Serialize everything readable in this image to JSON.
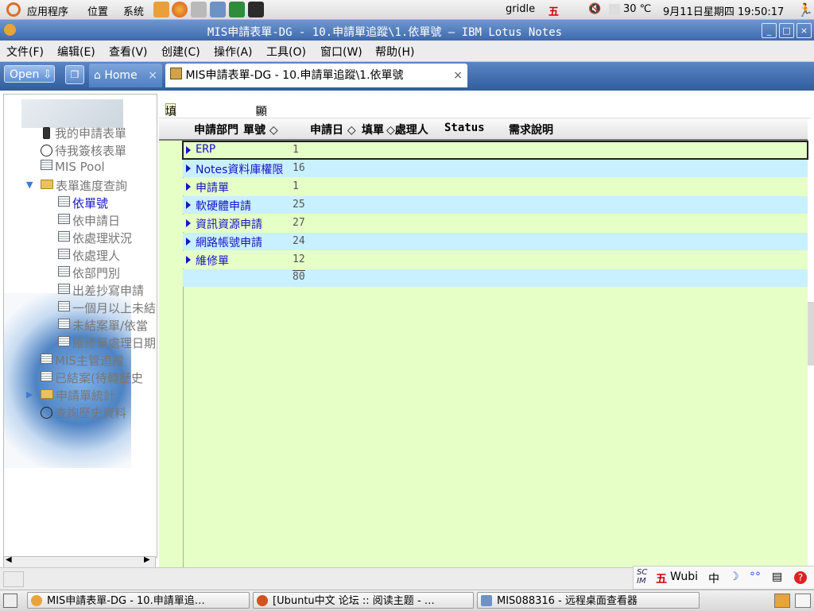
{
  "top_panel": {
    "menus": [
      "应用程序",
      "位置",
      "系统"
    ],
    "user": "gridle",
    "ime_indicator": "五",
    "temperature": "30 ℃",
    "datetime": "9月11日星期四 19:50:17"
  },
  "window": {
    "title": "MIS申請表單-DG - 10.申請單追蹤\\1.依單號 — IBM Lotus Notes"
  },
  "menubar": [
    "文件(F)",
    "编辑(E)",
    "查看(V)",
    "创建(C)",
    "操作(A)",
    "工具(O)",
    "窗口(W)",
    "帮助(H)"
  ],
  "tabs": {
    "open_label": "Open",
    "home_label": "Home",
    "active_label": "MIS申請表單-DG - 10.申請單追蹤\\1.依單號",
    "close_glyph": "×"
  },
  "navigator": {
    "items": [
      {
        "label": "我的申請表單",
        "icon": "person-icon",
        "level": 0
      },
      {
        "label": "待我簽核表單",
        "icon": "pen-icon",
        "level": 0
      },
      {
        "label": "MIS Pool",
        "icon": "view-icon",
        "level": 0
      },
      {
        "label": "表單進度查詢",
        "icon": "folder-open-icon",
        "level": 0
      },
      {
        "label": "依單號",
        "icon": "view-icon",
        "level": 1,
        "selected": true
      },
      {
        "label": "依申請日",
        "icon": "view-icon",
        "level": 1
      },
      {
        "label": "依處理狀況",
        "icon": "view-icon",
        "level": 1
      },
      {
        "label": "依處理人",
        "icon": "view-icon",
        "level": 1
      },
      {
        "label": "依部門別",
        "icon": "view-icon",
        "level": 1
      },
      {
        "label": "出差抄寫申請",
        "icon": "view-icon",
        "level": 1
      },
      {
        "label": "一個月以上未結",
        "icon": "view-icon",
        "level": 1
      },
      {
        "label": "未結案單/依當",
        "icon": "view-icon",
        "level": 1
      },
      {
        "label": "維修單處理日期",
        "icon": "view-icon",
        "level": 1
      },
      {
        "label": "MIS主管追蹤",
        "icon": "view-icon",
        "level": 0
      },
      {
        "label": "已結案(待轉歷史",
        "icon": "view-icon",
        "level": 0
      },
      {
        "label": "申請單統計",
        "icon": "folder-icon",
        "level": 0
      },
      {
        "label": "查詢歷史資料",
        "icon": "globe-icon",
        "level": 0
      }
    ]
  },
  "actions": {
    "new_request": "填寫申請單",
    "show_hscroll": "顯示水平捲軸"
  },
  "columns": [
    "申請部門",
    "單號 ◇",
    "申請日 ◇",
    "填單",
    "◇處理人",
    "Status",
    "需求說明"
  ],
  "rows": [
    {
      "category": "ERP",
      "count": "1"
    },
    {
      "category": "Notes資料庫權限",
      "count": "16"
    },
    {
      "category": "申請單",
      "count": "1"
    },
    {
      "category": "軟硬體申請",
      "count": "25"
    },
    {
      "category": "資訊資源申請",
      "count": "27"
    },
    {
      "category": "網路帳號申請",
      "count": "24"
    },
    {
      "category": "維修單",
      "count": "12"
    }
  ],
  "total": "80",
  "ime_bar": {
    "wubi_glyph": "五",
    "wubi_label": "Wubi",
    "lang": "中"
  },
  "taskbar": [
    "MIS申請表單-DG - 10.申請單追…",
    "[Ubuntu中文 论坛 :: 阅读主题 - …",
    "MIS088316 - 远程桌面查看器"
  ],
  "colors": {
    "view_bg": "#e5ffc7",
    "alt_row": "#c9f0ff",
    "category_text": "#1515c0",
    "title_bar": "#3d6aad"
  }
}
